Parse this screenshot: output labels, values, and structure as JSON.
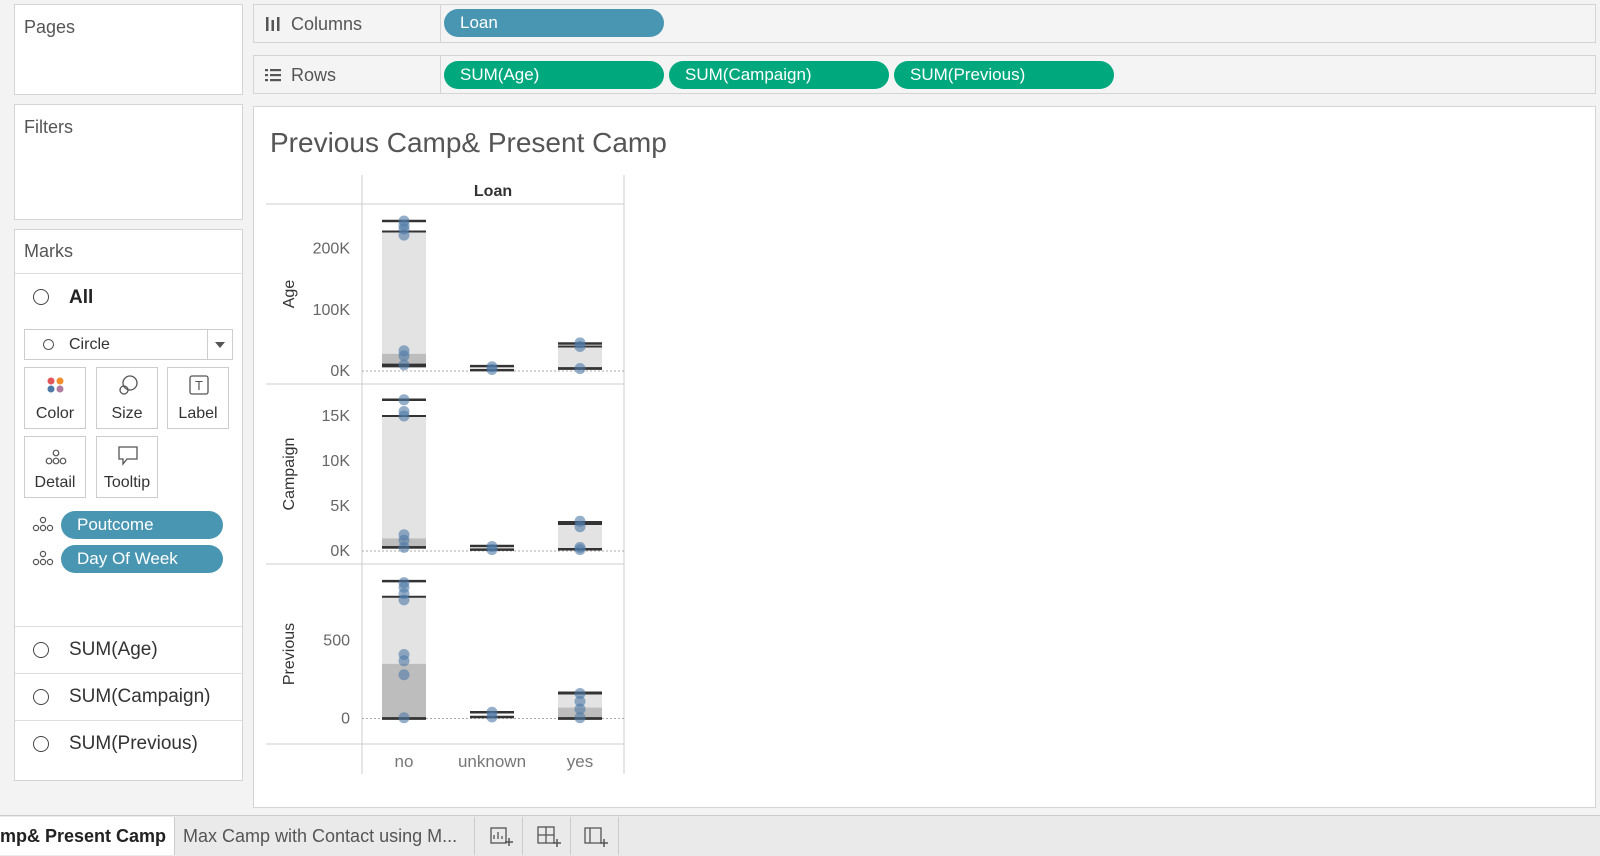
{
  "cards": {
    "pages": "Pages",
    "filters": "Filters",
    "marks": "Marks"
  },
  "shelves": {
    "columns_label": "Columns",
    "rows_label": "Rows",
    "columns_pills": [
      "Loan"
    ],
    "rows_pills": [
      "SUM(Age)",
      "SUM(Campaign)",
      "SUM(Previous)"
    ]
  },
  "marks": {
    "all_label": "All",
    "mark_type": "Circle",
    "buttons": [
      "Color",
      "Size",
      "Label",
      "Detail",
      "Tooltip"
    ],
    "detail_pills": [
      "Poutcome",
      "Day Of Week"
    ],
    "measure_tabs": [
      "SUM(Age)",
      "SUM(Campaign)",
      "SUM(Previous)"
    ]
  },
  "view": {
    "title": "Previous Camp& Present Camp"
  },
  "chart_data": {
    "type": "scatter",
    "title": "Previous Camp& Present Camp",
    "column_header": "Loan",
    "categories": [
      "no",
      "unknown",
      "yes"
    ],
    "panes": [
      {
        "name": "Age",
        "ylabel": "Age",
        "ylim": [
          0,
          250000
        ],
        "ticks": [
          {
            "v": 0,
            "t": "0K"
          },
          {
            "v": 100000,
            "t": "100K"
          },
          {
            "v": 200000,
            "t": "200K"
          }
        ],
        "bands": [
          {
            "cat": "no",
            "light": [
              10000,
              228000
            ],
            "dark": [
              10000,
              28000
            ],
            "whisk": [
              8000,
              245000
            ]
          },
          {
            "cat": "unknown",
            "whisk": [
              1500,
              8000
            ]
          },
          {
            "cat": "yes",
            "light": [
              4000,
              40000
            ],
            "whisk": [
              4000,
              45000
            ]
          }
        ],
        "points": [
          {
            "cat": "no",
            "v": 245000
          },
          {
            "cat": "no",
            "v": 238000
          },
          {
            "cat": "no",
            "v": 232000
          },
          {
            "cat": "no",
            "v": 222000
          },
          {
            "cat": "no",
            "v": 33000
          },
          {
            "cat": "no",
            "v": 25000
          },
          {
            "cat": "no",
            "v": 10000
          },
          {
            "cat": "unknown",
            "v": 7000
          },
          {
            "cat": "unknown",
            "v": 2500
          },
          {
            "cat": "yes",
            "v": 46000
          },
          {
            "cat": "yes",
            "v": 40000
          },
          {
            "cat": "yes",
            "v": 4000
          }
        ]
      },
      {
        "name": "Campaign",
        "ylabel": "Campaign",
        "ylim": [
          0,
          17000
        ],
        "ticks": [
          {
            "v": 0,
            "t": "0K"
          },
          {
            "v": 5000,
            "t": "5K"
          },
          {
            "v": 10000,
            "t": "10K"
          },
          {
            "v": 15000,
            "t": "15K"
          }
        ],
        "bands": [
          {
            "cat": "no",
            "light": [
              400,
              15000
            ],
            "dark": [
              400,
              1400
            ],
            "whisk": [
              400,
              16800
            ]
          },
          {
            "cat": "unknown",
            "whisk": [
              150,
              550
            ]
          },
          {
            "cat": "yes",
            "light": [
              200,
              3000
            ],
            "whisk": [
              200,
              3200
            ]
          }
        ],
        "points": [
          {
            "cat": "no",
            "v": 16800
          },
          {
            "cat": "no",
            "v": 15500
          },
          {
            "cat": "no",
            "v": 15000
          },
          {
            "cat": "no",
            "v": 1800
          },
          {
            "cat": "no",
            "v": 1200
          },
          {
            "cat": "no",
            "v": 400
          },
          {
            "cat": "unknown",
            "v": 500
          },
          {
            "cat": "unknown",
            "v": 150
          },
          {
            "cat": "yes",
            "v": 3300
          },
          {
            "cat": "yes",
            "v": 2700
          },
          {
            "cat": "yes",
            "v": 400
          },
          {
            "cat": "yes",
            "v": 150
          }
        ]
      },
      {
        "name": "Previous",
        "ylabel": "Previous",
        "ylim": [
          -80,
          900
        ],
        "ticks": [
          {
            "v": 0,
            "t": "0"
          },
          {
            "v": 500,
            "t": "500"
          }
        ],
        "bands": [
          {
            "cat": "no",
            "light": [
              0,
              780
            ],
            "dark": [
              0,
              350
            ],
            "whisk": [
              0,
              880
            ]
          },
          {
            "cat": "unknown",
            "whisk": [
              10,
              40
            ]
          },
          {
            "cat": "yes",
            "light": [
              0,
              160
            ],
            "dark": [
              0,
              70
            ],
            "whisk": [
              0,
              165
            ]
          }
        ],
        "points": [
          {
            "cat": "no",
            "v": 870
          },
          {
            "cat": "no",
            "v": 840
          },
          {
            "cat": "no",
            "v": 800
          },
          {
            "cat": "no",
            "v": 760
          },
          {
            "cat": "no",
            "v": 410
          },
          {
            "cat": "no",
            "v": 370
          },
          {
            "cat": "no",
            "v": 280
          },
          {
            "cat": "no",
            "v": 5
          },
          {
            "cat": "unknown",
            "v": 40
          },
          {
            "cat": "unknown",
            "v": 10
          },
          {
            "cat": "yes",
            "v": 160
          },
          {
            "cat": "yes",
            "v": 110
          },
          {
            "cat": "yes",
            "v": 60
          },
          {
            "cat": "yes",
            "v": 5
          }
        ]
      }
    ],
    "colors": {
      "mark": "#4e79a7",
      "light_band": "#e3e3e3",
      "dark_band": "#bdbdbd",
      "whisker": "#333333"
    }
  },
  "tabs": [
    {
      "label": "mp& Present Camp",
      "active": true
    },
    {
      "label": "Max Camp with Contact using M...",
      "active": false
    }
  ],
  "tab_icons": [
    "new-worksheet-icon",
    "new-dashboard-icon",
    "new-story-icon"
  ]
}
